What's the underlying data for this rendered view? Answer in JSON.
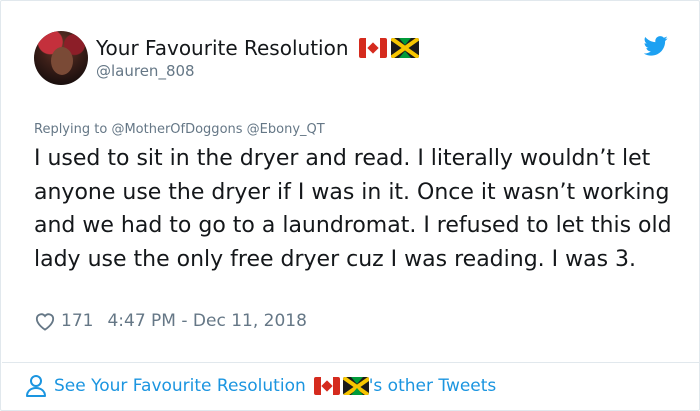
{
  "author": {
    "display_name": "Your Favourite Resolution",
    "handle": "@lauren_808",
    "name_flags": [
      "canada-flag-icon",
      "jamaica-flag-icon"
    ]
  },
  "reply": {
    "prefix": "Replying to",
    "mentions": [
      "@MotherOfDoggons",
      "@Ebony_QT"
    ]
  },
  "tweet": {
    "text": "I used to sit in the dryer and read. I literally wouldn’t let anyone use the dryer if I was in it. Once it wasn’t working and we had to go to a laundromat. I refused to let this old lady use the only free dryer cuz I was reading. I was 3."
  },
  "meta": {
    "likes": "171",
    "timestamp": "4:47 PM - Dec 11, 2018"
  },
  "footer": {
    "prefix": "See Your Favourite Resolution",
    "suffix": "'s other Tweets"
  },
  "colors": {
    "link": "#1b95e0",
    "muted": "#657786",
    "text": "#14171a",
    "border": "#e1e8ed",
    "twitter_blue": "#1da1f2"
  }
}
